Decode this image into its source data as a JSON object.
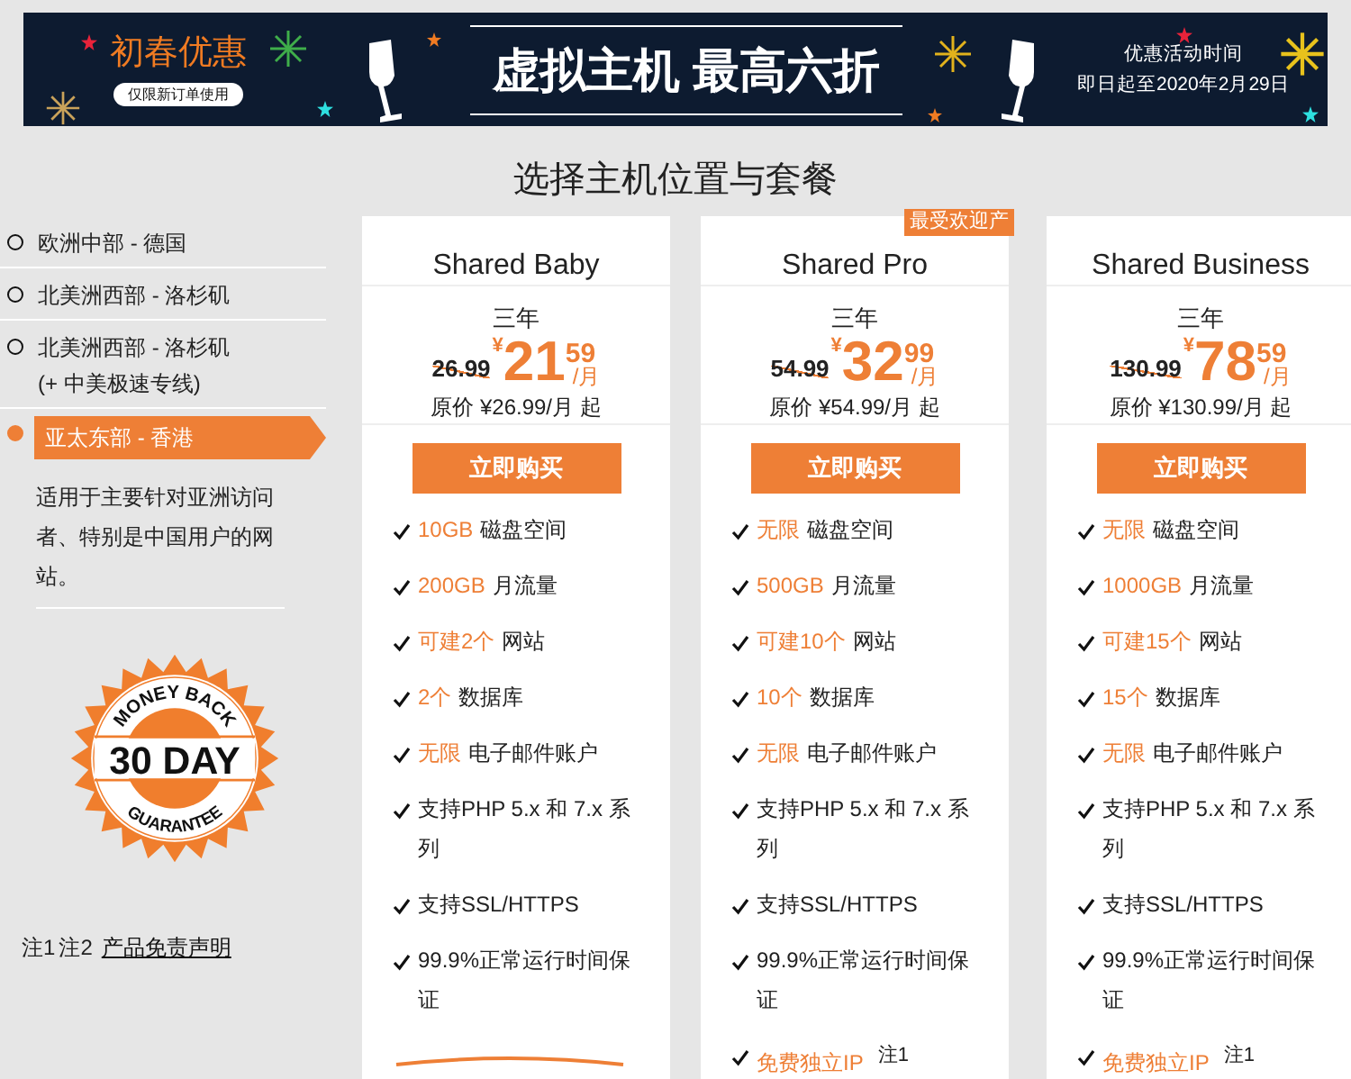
{
  "banner": {
    "promo_title": "初春优惠",
    "promo_note": "仅限新订单使用",
    "headline": "虚拟主机 最高六折",
    "period_label": "优惠活动时间",
    "period": "即日起至2020年2月29日"
  },
  "page_title": "选择主机位置与套餐",
  "locations": [
    {
      "label": "欧洲中部 - 德国",
      "selected": false
    },
    {
      "label": "北美洲西部 - 洛杉矶",
      "selected": false
    },
    {
      "label": "北美洲西部 - 洛杉矶",
      "sub": "(+ 中美极速专线)",
      "selected": false
    },
    {
      "label": "亚太东部 - 香港",
      "selected": true
    }
  ],
  "location_description": "适用于主要针对亚洲访问者、特别是中国用户的网站。",
  "guarantee": {
    "top": "MONEY BACK",
    "middle": "30 DAY",
    "bottom": "GUARANTEE"
  },
  "notes": {
    "note1": "注1",
    "note2": "注2",
    "link": "产品免责声明"
  },
  "plans": [
    {
      "name": "Shared Baby",
      "term": "三年",
      "old_price": "26.99",
      "currency": "¥",
      "price_int": "21",
      "price_dec": "59",
      "per": "/月",
      "original": "原价 ¥26.99/月 起",
      "button": "立即购买",
      "features": [
        {
          "hl": "10GB",
          "text": "磁盘空间"
        },
        {
          "hl": "200GB",
          "text": "月流量"
        },
        {
          "hl": "可建2个",
          "text": "网站"
        },
        {
          "hl": "2个",
          "text": "数据库"
        },
        {
          "hl": "无限",
          "text": "电子邮件账户"
        },
        {
          "text": "支持PHP 5.x 和 7.x 系列"
        },
        {
          "text": "支持SSL/HTTPS"
        },
        {
          "text": "99.9%正常运行时间保证"
        }
      ]
    },
    {
      "name": "Shared Pro",
      "badge": "最受欢迎产",
      "term": "三年",
      "old_price": "54.99",
      "currency": "¥",
      "price_int": "32",
      "price_dec": "99",
      "per": "/月",
      "original": "原价 ¥54.99/月 起",
      "button": "立即购买",
      "features": [
        {
          "hl": "无限",
          "text": "磁盘空间"
        },
        {
          "hl": "500GB",
          "text": "月流量"
        },
        {
          "hl": "可建10个",
          "text": "网站"
        },
        {
          "hl": "10个",
          "text": "数据库"
        },
        {
          "hl": "无限",
          "text": "电子邮件账户"
        },
        {
          "text": "支持PHP 5.x 和 7.x 系列"
        },
        {
          "text": "支持SSL/HTTPS"
        },
        {
          "text": "99.9%正常运行时间保证"
        },
        {
          "hl": "免费独立IP",
          "note": "注1"
        }
      ]
    },
    {
      "name": "Shared Business",
      "term": "三年",
      "old_price": "130.99",
      "currency": "¥",
      "price_int": "78",
      "price_dec": "59",
      "per": "/月",
      "original": "原价 ¥130.99/月 起",
      "button": "立即购买",
      "features": [
        {
          "hl": "无限",
          "text": "磁盘空间"
        },
        {
          "hl": "1000GB",
          "text": "月流量"
        },
        {
          "hl": "可建15个",
          "text": "网站"
        },
        {
          "hl": "15个",
          "text": "数据库"
        },
        {
          "hl": "无限",
          "text": "电子邮件账户"
        },
        {
          "text": "支持PHP 5.x 和 7.x 系列"
        },
        {
          "text": "支持SSL/HTTPS"
        },
        {
          "text": "99.9%正常运行时间保证"
        },
        {
          "hl": "免费独立IP",
          "note": "注1"
        }
      ]
    }
  ]
}
